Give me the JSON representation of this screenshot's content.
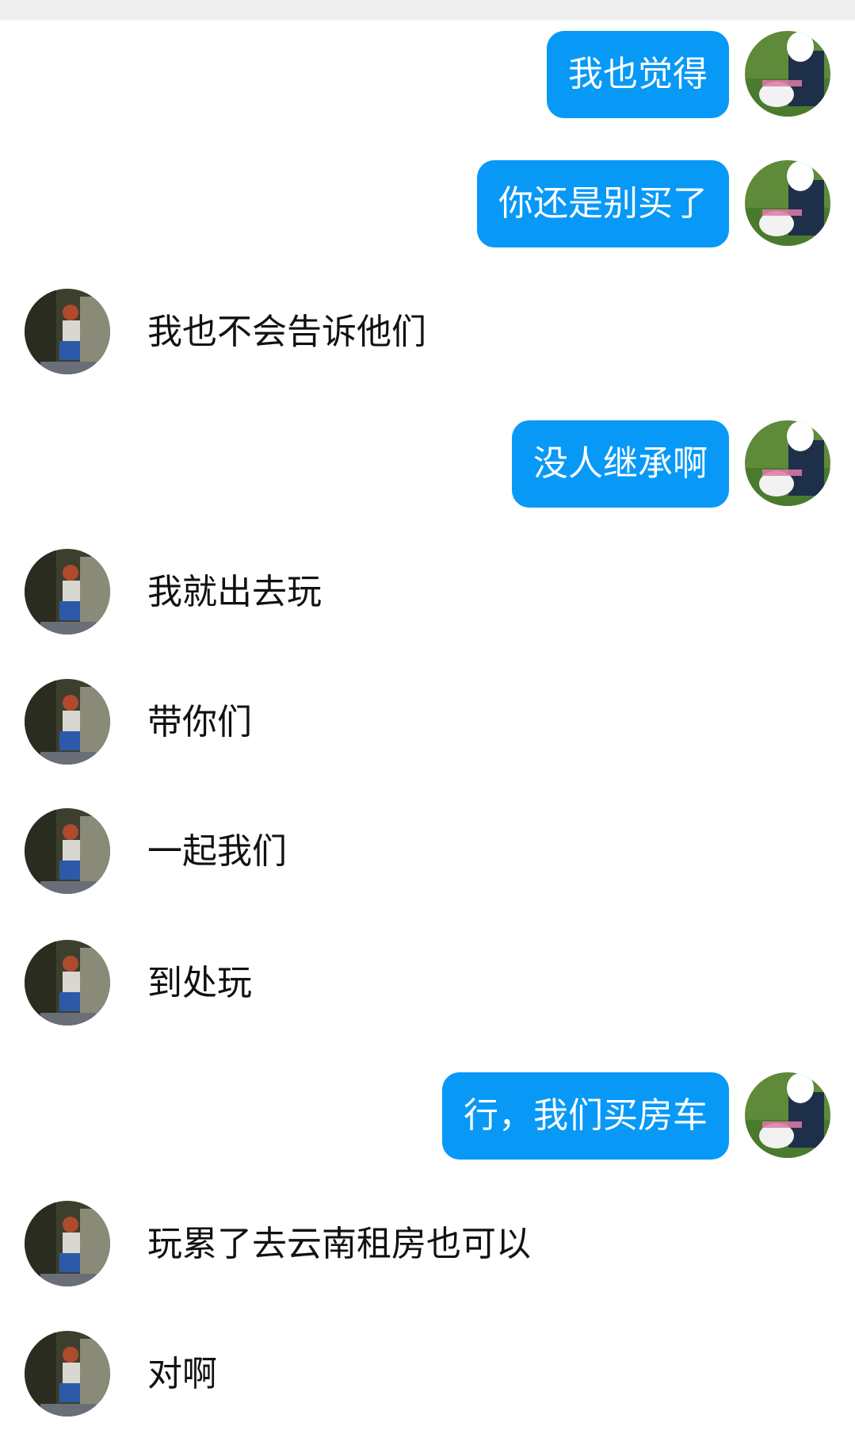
{
  "colors": {
    "outgoing_bubble": "#0899f7",
    "outgoing_text": "#ffffff",
    "incoming_text": "#111111",
    "background": "#ffffff",
    "top_strip": "#eeeeef"
  },
  "messages": [
    {
      "side": "right",
      "text": "我也觉得"
    },
    {
      "side": "right",
      "text": "你还是别买了"
    },
    {
      "side": "left",
      "text": "我也不会告诉他们"
    },
    {
      "side": "right",
      "text": "没人继承啊"
    },
    {
      "side": "left",
      "text": "我就出去玩"
    },
    {
      "side": "left",
      "text": "带你们"
    },
    {
      "side": "left",
      "text": "一起我们"
    },
    {
      "side": "left",
      "text": "到处玩"
    },
    {
      "side": "right",
      "text": "行，我们买房车"
    },
    {
      "side": "left",
      "text": "玩累了去云南租房也可以"
    },
    {
      "side": "left",
      "text": "对啊"
    }
  ]
}
